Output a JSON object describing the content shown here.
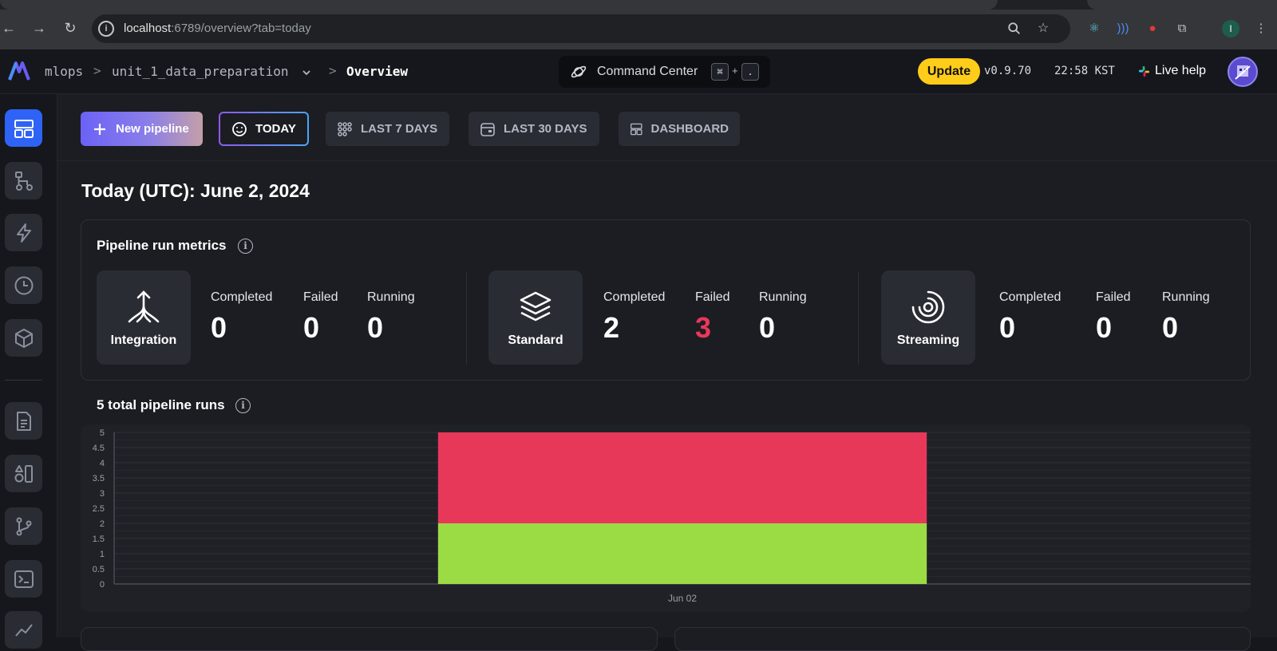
{
  "browser": {
    "url_host": "localhost",
    "url_rest": ":6789/overview?tab=today"
  },
  "header": {
    "breadcrumb": [
      "mlops",
      "unit_1_data_preparation",
      "Overview"
    ],
    "command_center_label": "Command Center",
    "shortcut_keys": [
      "⌘",
      "+",
      "."
    ],
    "update_label": "Update",
    "version": "v0.9.70",
    "time": "22:58 KST",
    "live_help_label": "Live help"
  },
  "toolbar": {
    "tabs": [
      {
        "label": "New pipeline",
        "icon": "plus-icon"
      },
      {
        "label": "TODAY",
        "icon": "smiley-icon",
        "active": true
      },
      {
        "label": "LAST 7 DAYS",
        "icon": "grid-dots-icon"
      },
      {
        "label": "LAST 30 DAYS",
        "icon": "calendar-icon"
      },
      {
        "label": "DASHBOARD",
        "icon": "layout-icon"
      }
    ]
  },
  "page_title": "Today (UTC): June 2, 2024",
  "metrics": {
    "title": "Pipeline run metrics",
    "groups": [
      {
        "type": "Integration",
        "icon": "integration-icon",
        "completed": "0",
        "failed": "0",
        "running": "0"
      },
      {
        "type": "Standard",
        "icon": "layers-icon",
        "completed": "2",
        "failed": "3",
        "running": "0"
      },
      {
        "type": "Streaming",
        "icon": "streaming-icon",
        "completed": "0",
        "failed": "0",
        "running": "0"
      }
    ],
    "labels": {
      "completed": "Completed",
      "failed": "Failed",
      "running": "Running"
    }
  },
  "runs": {
    "title": "5 total pipeline runs"
  },
  "colors": {
    "accent": "#2f63f5",
    "failed": "#e8385a",
    "completed": "#9bdc45",
    "update": "#ffcc19"
  },
  "chart_data": {
    "type": "bar",
    "stacked": true,
    "categories": [
      "Jun 02"
    ],
    "series": [
      {
        "values": [
          2
        ],
        "color": "#9bdc45"
      },
      {
        "values": [
          3
        ],
        "color": "#e8385a"
      }
    ],
    "ylim": [
      0,
      5
    ],
    "yticks": [
      "0",
      "0.5",
      "1",
      "1.5",
      "2",
      "2.5",
      "3",
      "3.5",
      "4",
      "4.5",
      "5"
    ],
    "grid": true
  },
  "sidebar": {
    "items": [
      {
        "name": "overview",
        "icon": "overview-layout-icon",
        "active": true
      },
      {
        "name": "pipelines",
        "icon": "pipeline-tree-icon"
      },
      {
        "name": "triggers",
        "icon": "lightning-icon"
      },
      {
        "name": "runs",
        "icon": "clock-icon"
      },
      {
        "name": "blocks",
        "icon": "cube-icon"
      },
      {
        "name": "files",
        "icon": "document-icon"
      },
      {
        "name": "templates",
        "icon": "shapes-icon"
      },
      {
        "name": "version-control",
        "icon": "git-branch-icon"
      },
      {
        "name": "terminal",
        "icon": "terminal-icon"
      },
      {
        "name": "monitoring",
        "icon": "chart-line-icon"
      }
    ]
  }
}
